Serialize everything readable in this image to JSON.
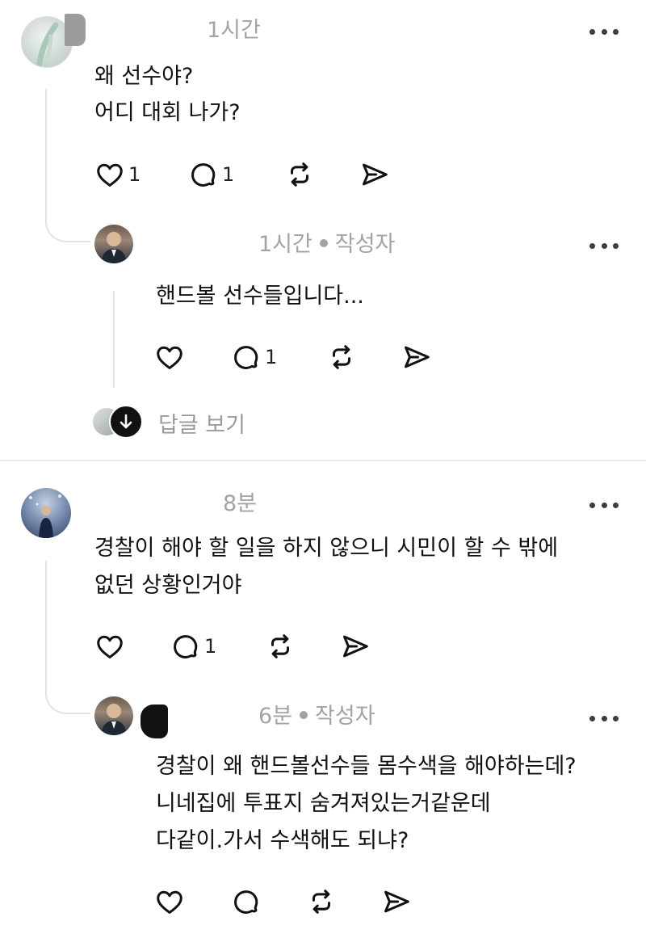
{
  "comments": [
    {
      "meta": {
        "time": "1시간"
      },
      "lines": [
        "왜 선수야?",
        "어디 대회 나가?"
      ],
      "actions": {
        "like_count": "1",
        "reply_count": "1"
      }
    },
    {
      "meta": {
        "time": "1시간",
        "author_tag": "작성자"
      },
      "lines": [
        "핸드볼 선수들입니다..."
      ],
      "actions": {
        "reply_count": "1"
      }
    },
    {
      "meta": {
        "time": "8분"
      },
      "lines": [
        "경찰이 해야 할 일을 하지 않으니 시민이 할 수 밖에",
        "없던 상황인거야"
      ],
      "actions": {
        "reply_count": "1"
      }
    },
    {
      "meta": {
        "time": "6분",
        "author_tag": "작성자"
      },
      "lines": [
        "경찰이 왜 핸드볼선수들 몸수색을 해야하는데?",
        "니네집에 투표지 숨겨져있는거같운데",
        "다같이.가서 수색해도 되냐?"
      ],
      "actions": {}
    }
  ],
  "view_replies": {
    "label": "답글 보기"
  },
  "icons": {
    "like": "heart-icon",
    "reply": "speech-bubble-icon",
    "repost": "repost-arrows-icon",
    "share": "send-paper-plane-icon",
    "more": "more-horizontal-icon",
    "expand": "arrow-down-icon"
  },
  "colors": {
    "meta_text": "#a3a3a3",
    "icon": "#111111",
    "thread_line": "#e4e4e4"
  }
}
